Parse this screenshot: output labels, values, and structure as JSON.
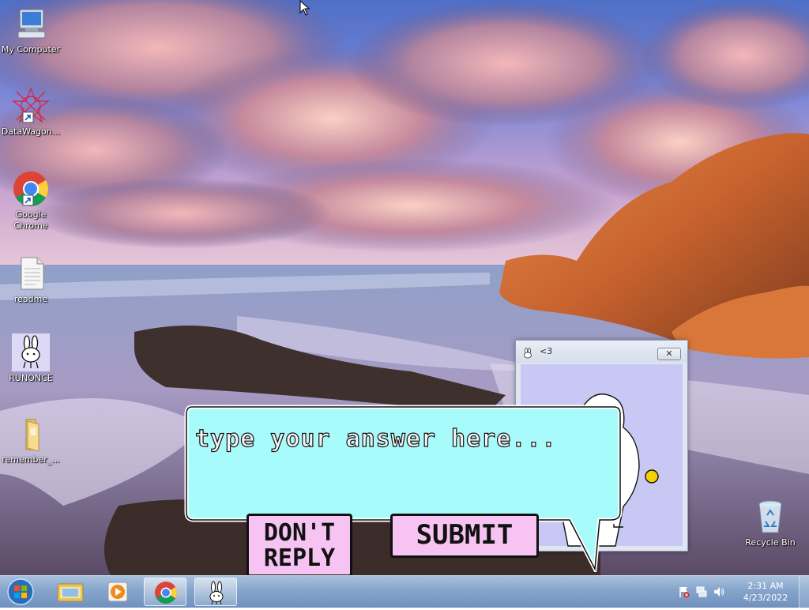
{
  "desktop": {
    "icons": [
      {
        "label": "My Computer",
        "icon": "computer-icon"
      },
      {
        "label": "DataWagon...",
        "icon": "datawagon-shortcut-icon"
      },
      {
        "label": "Google Chrome",
        "icon": "chrome-shortcut-icon"
      },
      {
        "label": "readme",
        "icon": "text-file-icon"
      },
      {
        "label": "RUNONCE",
        "icon": "bunny-app-icon"
      },
      {
        "label": "remember_...",
        "icon": "folder-icon"
      },
      {
        "label": "Recycle Bin",
        "icon": "recycle-bin-icon"
      }
    ]
  },
  "heart_window": {
    "title": "<3",
    "close_glyph": "✕"
  },
  "answer_box": {
    "placeholder": "type your answer here...",
    "value": ""
  },
  "buttons": {
    "dont_reply_line1": "DON'T",
    "dont_reply_line2": "REPLY",
    "submit": "SUBMIT"
  },
  "taskbar": {
    "pinned": [
      "windows-explorer-icon",
      "media-player-icon",
      "chrome-icon",
      "bunny-app-icon"
    ],
    "active_item": "bunny-app-icon",
    "clock_time": "2:31 AM",
    "clock_date": "4/23/2022"
  },
  "colors": {
    "bubble_fill": "#a8fbfb",
    "button_fill": "#f6c3f2",
    "window_client": "#c9c8f4",
    "taskbar": "#86a5cc"
  }
}
